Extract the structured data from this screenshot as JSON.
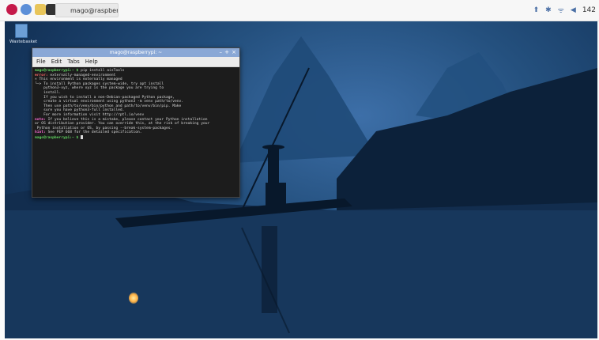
{
  "taskbar": {
    "task_label": "mago@raspberrypi...",
    "clock": "142"
  },
  "desktop": {
    "icon_label": "Wastebasket"
  },
  "terminal": {
    "title": "mago@raspberrypi: ~",
    "menu": [
      "File",
      "Edit",
      "Tabs",
      "Help"
    ],
    "lines": [
      {
        "kind": "prompt",
        "prompt": "mago@raspberrypi:~ $",
        "text": " pip install aisTools"
      },
      {
        "kind": "error",
        "label": "error:",
        "text": " externally-managed-environment"
      },
      {
        "kind": "plain",
        "text": ""
      },
      {
        "kind": "plain",
        "text": "× This environment is externally managed"
      },
      {
        "kind": "plain",
        "text": "╰─> To install Python packages system-wide, try apt install"
      },
      {
        "kind": "plain",
        "text": "    python3-xyz, where xyz is the package you are trying to"
      },
      {
        "kind": "plain",
        "text": "    install."
      },
      {
        "kind": "plain",
        "text": ""
      },
      {
        "kind": "plain",
        "text": "    If you wish to install a non-Debian-packaged Python package,"
      },
      {
        "kind": "plain",
        "text": "    create a virtual environment using python3 -m venv path/to/venv."
      },
      {
        "kind": "plain",
        "text": "    Then use path/to/venv/bin/python and path/to/venv/bin/pip. Make"
      },
      {
        "kind": "plain",
        "text": "    sure you have python3-full installed."
      },
      {
        "kind": "plain",
        "text": ""
      },
      {
        "kind": "plain",
        "text": "    For more information visit http://rptl.io/venv"
      },
      {
        "kind": "plain",
        "text": ""
      },
      {
        "kind": "note",
        "label": "note:",
        "text": " If you believe this is a mistake, please contact your Python installation"
      },
      {
        "kind": "plain",
        "text": "or OS distribution provider. You can override this, at the risk of breaking your"
      },
      {
        "kind": "plain",
        "text": " Python installation or OS, by passing --break-system-packages."
      },
      {
        "kind": "hint",
        "label": "hint:",
        "text": " See PEP 668 for the detailed specification."
      },
      {
        "kind": "prompt",
        "prompt": "mago@raspberrypi:~ $",
        "text": " "
      }
    ]
  }
}
